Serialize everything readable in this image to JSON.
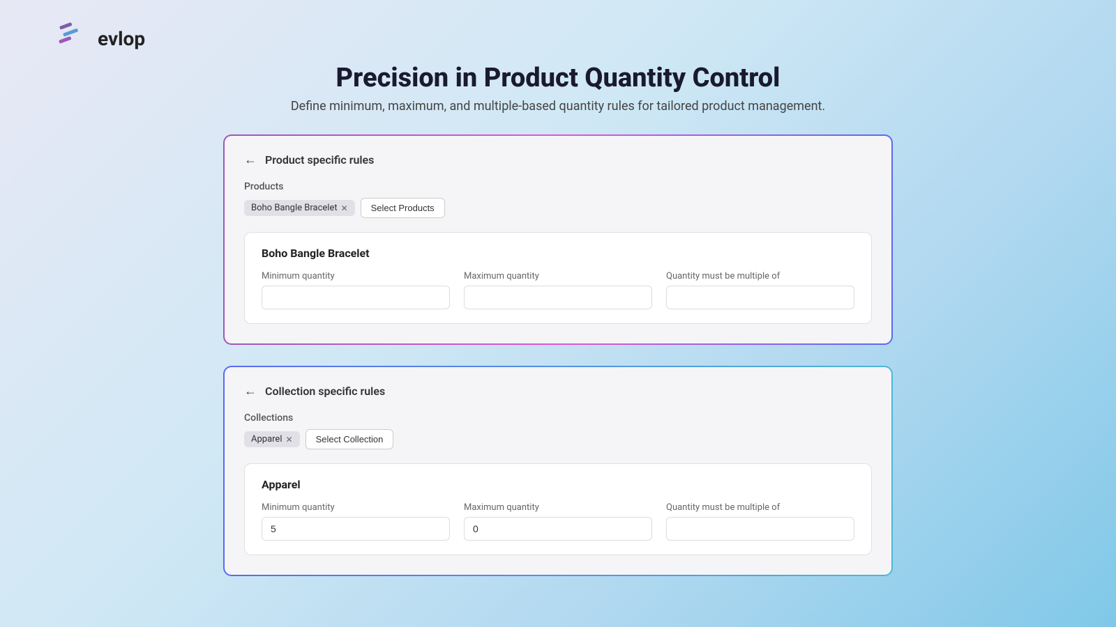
{
  "logo": {
    "text": "evlop"
  },
  "page": {
    "title": "Precision in Product Quantity Control",
    "subtitle": "Define minimum, maximum, and multiple-based quantity rules for tailored product management."
  },
  "product_card": {
    "back_label": "←",
    "title": "Product specific rules",
    "section_label": "Products",
    "tag_label": "Boho Bangle Bracelet",
    "select_btn": "Select Products",
    "product_name": "Boho Bangle Bracelet",
    "min_label": "Minimum quantity",
    "max_label": "Maximum quantity",
    "multiple_label": "Quantity must be multiple of",
    "min_value": "",
    "max_value": "",
    "multiple_value": ""
  },
  "collection_card": {
    "back_label": "←",
    "title": "Collection specific rules",
    "section_label": "Collections",
    "tag_label": "Apparel",
    "select_btn": "Select Collection",
    "collection_name": "Apparel",
    "min_label": "Minimum quantity",
    "max_label": "Maximum quantity",
    "multiple_label": "Quantity must be multiple of",
    "min_value": "5",
    "max_value": "0",
    "multiple_value": ""
  }
}
